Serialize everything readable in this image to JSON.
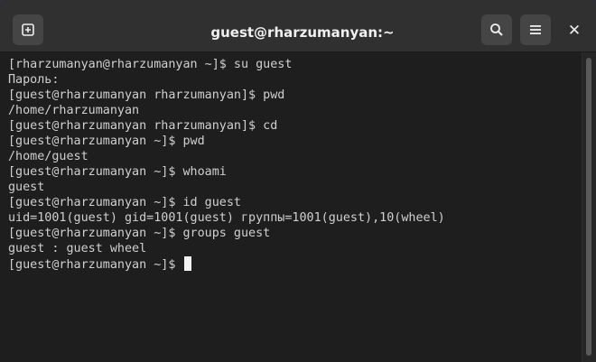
{
  "window": {
    "title": "guest@rharzumanyan:~"
  },
  "headerbar": {
    "buttons": [
      {
        "name": "new-tab",
        "icon": "new-tab-icon"
      },
      {
        "name": "search",
        "icon": "search-icon"
      },
      {
        "name": "menu",
        "icon": "hamburger-menu-icon"
      },
      {
        "name": "close",
        "icon": "close-icon",
        "glyph": "✕"
      }
    ]
  },
  "terminal": {
    "lines": [
      "[rharzumanyan@rharzumanyan ~]$ su guest",
      "Пароль:",
      "[guest@rharzumanyan rharzumanyan]$ pwd",
      "/home/rharzumanyan",
      "[guest@rharzumanyan rharzumanyan]$ cd",
      "[guest@rharzumanyan ~]$ pwd",
      "/home/guest",
      "[guest@rharzumanyan ~]$ whoami",
      "guest",
      "[guest@rharzumanyan ~]$ id guest",
      "uid=1001(guest) gid=1001(guest) группы=1001(guest),10(wheel)",
      "[guest@rharzumanyan ~]$ groups guest",
      "guest : guest wheel",
      "[guest@rharzumanyan ~]$ "
    ]
  },
  "colors": {
    "headerbar": "#303030",
    "terminal_bg": "#1e1e1e",
    "terminal_fg": "#d0d0d0",
    "button_bg": "#454545"
  }
}
